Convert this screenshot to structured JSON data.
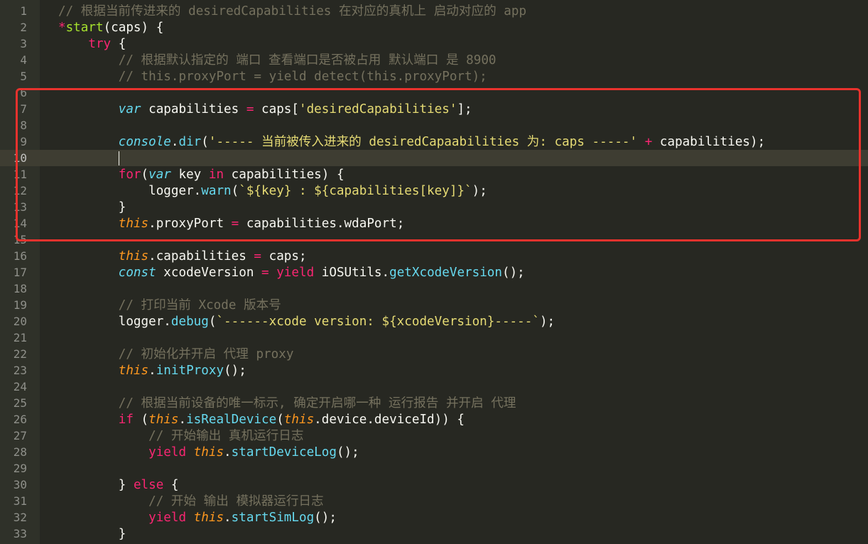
{
  "editor": {
    "theme_colors": {
      "background": "#272822",
      "gutter": "#2f3129",
      "comment": "#75715e",
      "keyword": "#f92672",
      "storage": "#66d9ef",
      "this": "#fd971f",
      "function": "#a6e22e",
      "string": "#e6db74",
      "annotation_box": "#e8322d"
    },
    "current_line": 10,
    "lines": [
      {
        "n": "1",
        "tokens": [
          [
            "comment",
            "// 根据当前传进来的 desiredCapabilities 在对应的真机上 启动对应的 app"
          ]
        ]
      },
      {
        "n": "2",
        "tokens": [
          [
            "keyword",
            "*"
          ],
          [
            "func",
            "start"
          ],
          [
            "plain",
            "(caps) {"
          ]
        ]
      },
      {
        "n": "3",
        "tokens": [
          [
            "plain",
            "    "
          ],
          [
            "keyword",
            "try"
          ],
          [
            "plain",
            " {"
          ]
        ]
      },
      {
        "n": "4",
        "tokens": [
          [
            "plain",
            "        "
          ],
          [
            "comment",
            "// 根据默认指定的 端口 查看端口是否被占用 默认端口 是 8900"
          ]
        ]
      },
      {
        "n": "5",
        "tokens": [
          [
            "plain",
            "        "
          ],
          [
            "comment",
            "// this.proxyPort = yield detect(this.proxyPort);"
          ]
        ]
      },
      {
        "n": "6",
        "tokens": []
      },
      {
        "n": "7",
        "tokens": [
          [
            "plain",
            "        "
          ],
          [
            "storage",
            "var"
          ],
          [
            "plain",
            " capabilities "
          ],
          [
            "keyword",
            "="
          ],
          [
            "plain",
            " caps["
          ],
          [
            "string",
            "'desiredCapabilities'"
          ],
          [
            "plain",
            "];"
          ]
        ]
      },
      {
        "n": "8",
        "tokens": []
      },
      {
        "n": "9",
        "tokens": [
          [
            "plain",
            "        "
          ],
          [
            "storage",
            "console"
          ],
          [
            "plain",
            "."
          ],
          [
            "method",
            "dir"
          ],
          [
            "plain",
            "("
          ],
          [
            "string",
            "'----- 当前被传入进来的 desiredCapaabilities 为: caps -----'"
          ],
          [
            "plain",
            " "
          ],
          [
            "keyword",
            "+"
          ],
          [
            "plain",
            " capabilities);"
          ]
        ]
      },
      {
        "n": "10",
        "tokens": [
          [
            "plain",
            "        "
          ],
          [
            "caret",
            ""
          ]
        ]
      },
      {
        "n": "11",
        "tokens": [
          [
            "plain",
            "        "
          ],
          [
            "keyword",
            "for"
          ],
          [
            "plain",
            "("
          ],
          [
            "storage",
            "var"
          ],
          [
            "plain",
            " key "
          ],
          [
            "keyword",
            "in"
          ],
          [
            "plain",
            " capabilities) {"
          ]
        ]
      },
      {
        "n": "12",
        "tokens": [
          [
            "plain",
            "            logger."
          ],
          [
            "method",
            "warn"
          ],
          [
            "plain",
            "("
          ],
          [
            "string",
            "`${key} : ${capabilities[key]}`"
          ],
          [
            "plain",
            ");"
          ]
        ]
      },
      {
        "n": "13",
        "tokens": [
          [
            "plain",
            "        }"
          ]
        ]
      },
      {
        "n": "14",
        "tokens": [
          [
            "plain",
            "        "
          ],
          [
            "this",
            "this"
          ],
          [
            "plain",
            ".proxyPort "
          ],
          [
            "keyword",
            "="
          ],
          [
            "plain",
            " capabilities.wdaPort;"
          ]
        ]
      },
      {
        "n": "15",
        "tokens": []
      },
      {
        "n": "16",
        "tokens": [
          [
            "plain",
            "        "
          ],
          [
            "this",
            "this"
          ],
          [
            "plain",
            ".capabilities "
          ],
          [
            "keyword",
            "="
          ],
          [
            "plain",
            " caps;"
          ]
        ]
      },
      {
        "n": "17",
        "tokens": [
          [
            "plain",
            "        "
          ],
          [
            "storage",
            "const"
          ],
          [
            "plain",
            " xcodeVersion "
          ],
          [
            "keyword",
            "="
          ],
          [
            "plain",
            " "
          ],
          [
            "keyword",
            "yield"
          ],
          [
            "plain",
            " iOSUtils."
          ],
          [
            "method",
            "getXcodeVersion"
          ],
          [
            "plain",
            "();"
          ]
        ]
      },
      {
        "n": "18",
        "tokens": []
      },
      {
        "n": "19",
        "tokens": [
          [
            "plain",
            "        "
          ],
          [
            "comment",
            "// 打印当前 Xcode 版本号"
          ]
        ]
      },
      {
        "n": "20",
        "tokens": [
          [
            "plain",
            "        logger."
          ],
          [
            "method",
            "debug"
          ],
          [
            "plain",
            "("
          ],
          [
            "string",
            "`------xcode version: ${xcodeVersion}-----`"
          ],
          [
            "plain",
            ");"
          ]
        ]
      },
      {
        "n": "21",
        "tokens": []
      },
      {
        "n": "22",
        "tokens": [
          [
            "plain",
            "        "
          ],
          [
            "comment",
            "// 初始化并开启 代理 proxy"
          ]
        ]
      },
      {
        "n": "23",
        "tokens": [
          [
            "plain",
            "        "
          ],
          [
            "this",
            "this"
          ],
          [
            "plain",
            "."
          ],
          [
            "method",
            "initProxy"
          ],
          [
            "plain",
            "();"
          ]
        ]
      },
      {
        "n": "24",
        "tokens": []
      },
      {
        "n": "25",
        "tokens": [
          [
            "plain",
            "        "
          ],
          [
            "comment",
            "// 根据当前设备的唯一标示, 确定开启哪一种 运行报告 并开启 代理"
          ]
        ]
      },
      {
        "n": "26",
        "tokens": [
          [
            "plain",
            "        "
          ],
          [
            "keyword",
            "if"
          ],
          [
            "plain",
            " ("
          ],
          [
            "this",
            "this"
          ],
          [
            "plain",
            "."
          ],
          [
            "method",
            "isRealDevice"
          ],
          [
            "plain",
            "("
          ],
          [
            "this",
            "this"
          ],
          [
            "plain",
            ".device.deviceId)) {"
          ]
        ]
      },
      {
        "n": "27",
        "tokens": [
          [
            "plain",
            "            "
          ],
          [
            "comment",
            "// 开始输出 真机运行日志"
          ]
        ]
      },
      {
        "n": "28",
        "tokens": [
          [
            "plain",
            "            "
          ],
          [
            "keyword",
            "yield"
          ],
          [
            "plain",
            " "
          ],
          [
            "this",
            "this"
          ],
          [
            "plain",
            "."
          ],
          [
            "method",
            "startDeviceLog"
          ],
          [
            "plain",
            "();"
          ]
        ]
      },
      {
        "n": "29",
        "tokens": []
      },
      {
        "n": "30",
        "tokens": [
          [
            "plain",
            "        } "
          ],
          [
            "keyword",
            "else"
          ],
          [
            "plain",
            " {"
          ]
        ]
      },
      {
        "n": "31",
        "tokens": [
          [
            "plain",
            "            "
          ],
          [
            "comment",
            "// 开始 输出 模拟器运行日志"
          ]
        ]
      },
      {
        "n": "32",
        "tokens": [
          [
            "plain",
            "            "
          ],
          [
            "keyword",
            "yield"
          ],
          [
            "plain",
            " "
          ],
          [
            "this",
            "this"
          ],
          [
            "plain",
            "."
          ],
          [
            "method",
            "startSimLog"
          ],
          [
            "plain",
            "();"
          ]
        ]
      },
      {
        "n": "33",
        "tokens": [
          [
            "plain",
            "        }"
          ]
        ]
      }
    ]
  }
}
